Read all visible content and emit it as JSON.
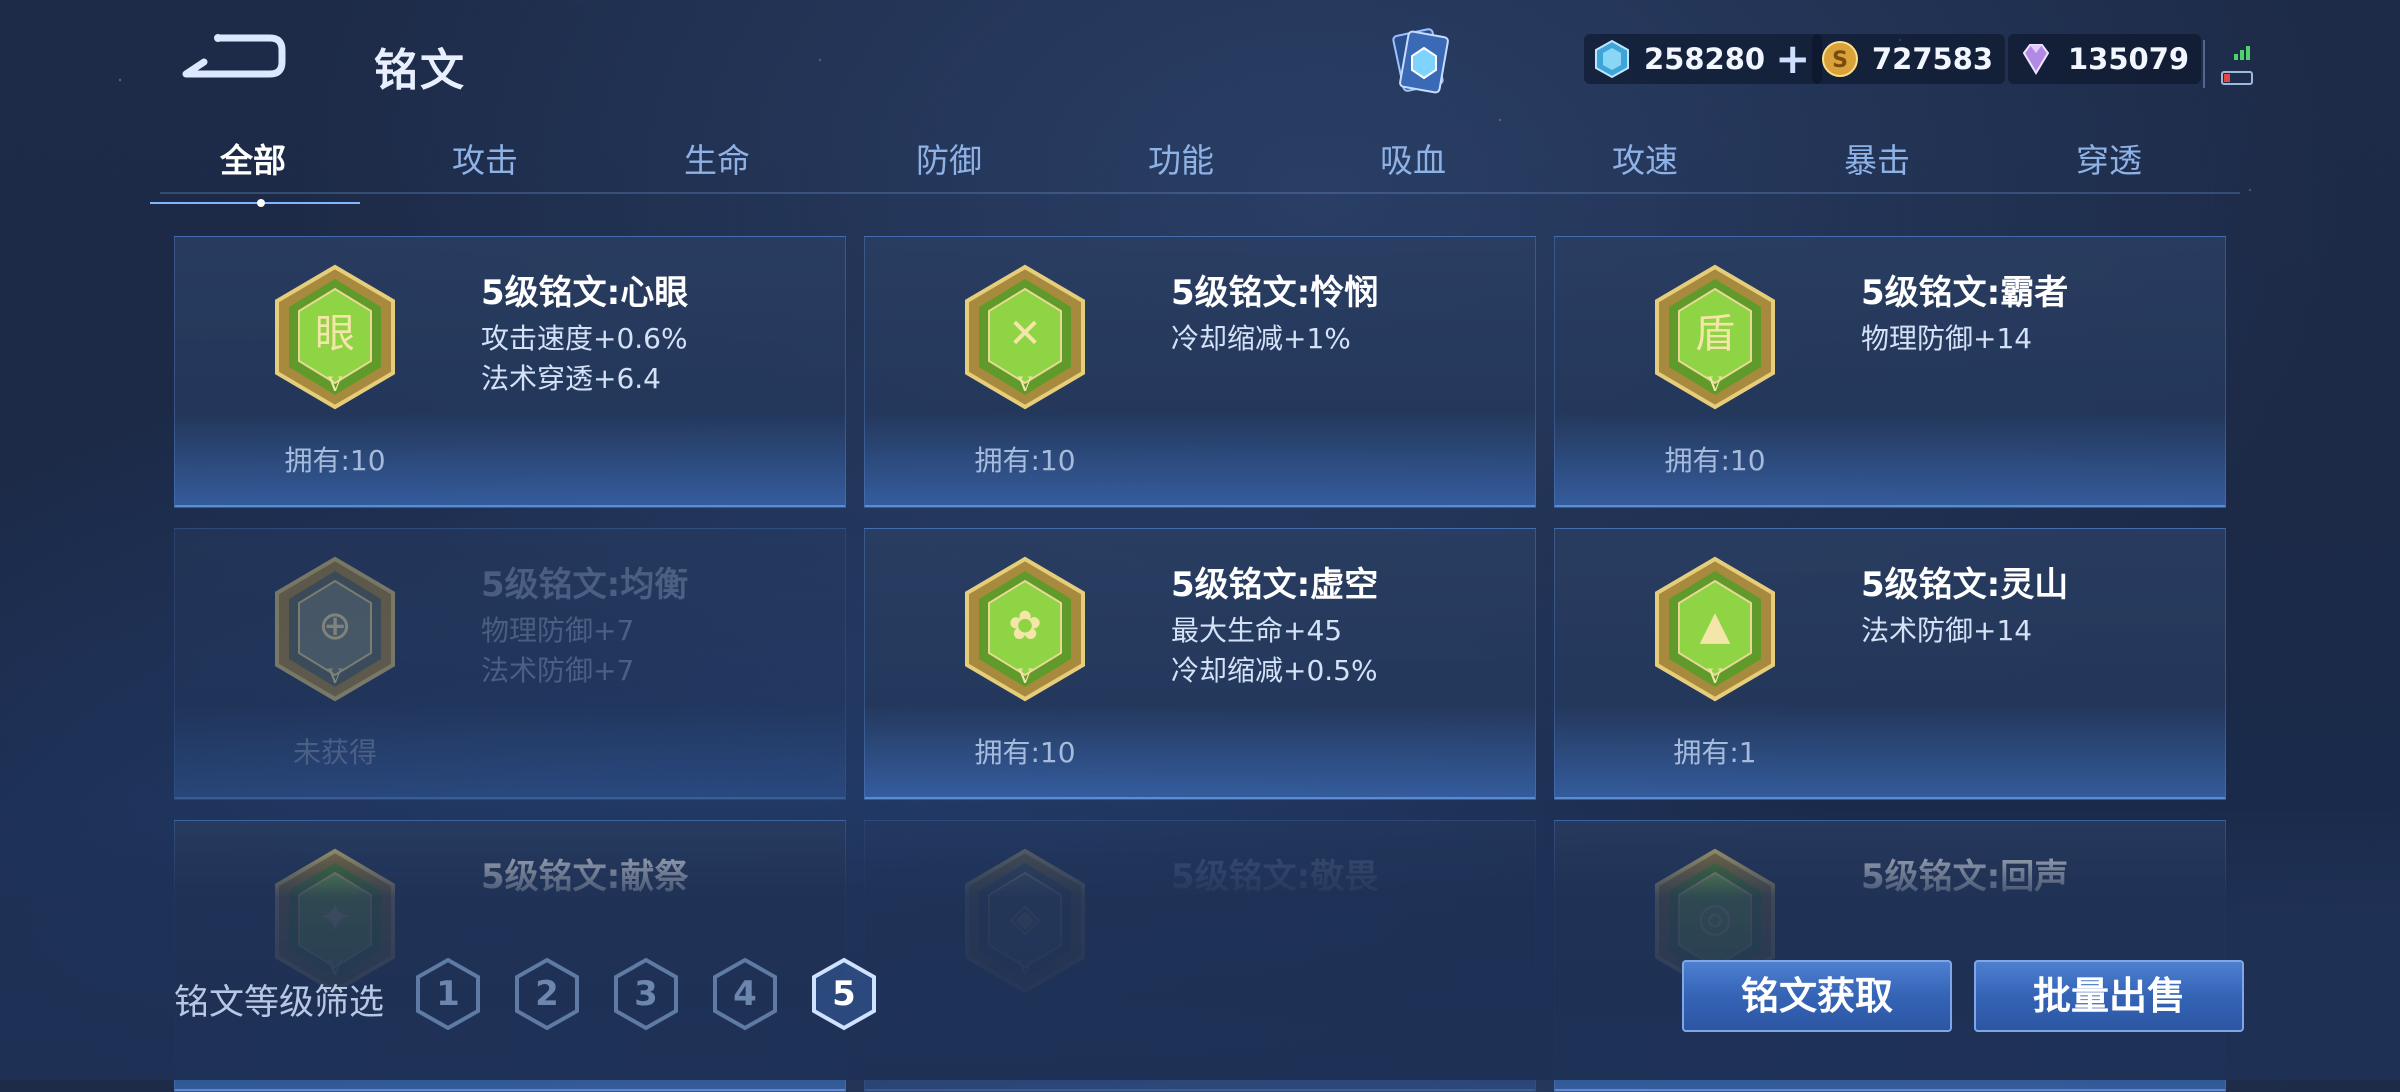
{
  "header": {
    "title": "铭文",
    "currencies": [
      {
        "icon": "diamond-icon",
        "value": "258280",
        "has_plus": true
      },
      {
        "icon": "gold-coin-icon",
        "value": "727583"
      },
      {
        "icon": "gem-icon",
        "value": "135079"
      }
    ]
  },
  "tabs": [
    "全部",
    "攻击",
    "生命",
    "防御",
    "功能",
    "吸血",
    "攻速",
    "暴击",
    "穿透"
  ],
  "active_tab": "全部",
  "cards": [
    {
      "name": "5级铭文:心眼",
      "stats": [
        "攻击速度+0.6%",
        "法术穿透+6.4"
      ],
      "owned": "拥有:10",
      "emblem_icon": "xinyan-emblem-icon"
    },
    {
      "name": "5级铭文:怜悯",
      "stats": [
        "冷却缩减+1%"
      ],
      "owned": "拥有:10",
      "emblem_icon": "lianmin-emblem-icon"
    },
    {
      "name": "5级铭文:霸者",
      "stats": [
        "物理防御+14"
      ],
      "owned": "拥有:10",
      "emblem_icon": "bazhe-emblem-icon"
    },
    {
      "name": "5级铭文:均衡",
      "stats": [
        "物理防御+7",
        "法术防御+7"
      ],
      "owned": "未获得",
      "emblem_icon": "junheng-emblem-icon",
      "unowned": true
    },
    {
      "name": "5级铭文:虚空",
      "stats": [
        "最大生命+45",
        "冷却缩减+0.5%"
      ],
      "owned": "拥有:10",
      "emblem_icon": "xukong-emblem-icon"
    },
    {
      "name": "5级铭文:灵山",
      "stats": [
        "法术防御+14"
      ],
      "owned": "拥有:1",
      "emblem_icon": "lingshan-emblem-icon"
    },
    {
      "name": "5级铭文:献祭",
      "stats": [],
      "owned": "",
      "emblem_icon": "xianji-emblem-icon"
    },
    {
      "name": "5级铭文:敬畏",
      "stats": [],
      "owned": "",
      "emblem_icon": "jingwei-emblem-icon",
      "unowned": true
    },
    {
      "name": "5级铭文:回声",
      "stats": [],
      "owned": "",
      "emblem_icon": "huisheng-emblem-icon"
    }
  ],
  "filter": {
    "label": "铭文等级筛选",
    "levels": [
      "1",
      "2",
      "3",
      "4",
      "5"
    ],
    "active_level": "5"
  },
  "buttons": {
    "acquire": "铭文获取",
    "bulk_sell": "批量出售"
  }
}
